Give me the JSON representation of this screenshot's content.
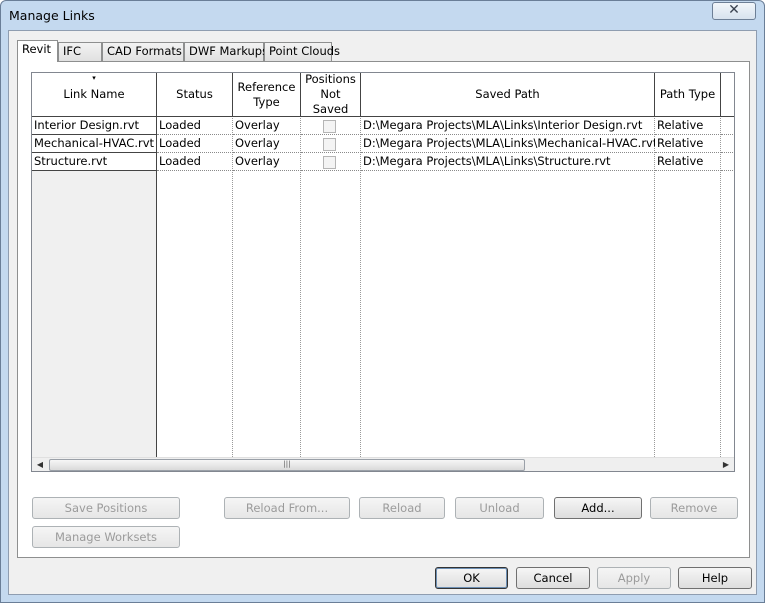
{
  "window": {
    "title": "Manage Links",
    "close_glyph": "✕"
  },
  "tabs": [
    {
      "label": "Revit",
      "active": true
    },
    {
      "label": "IFC"
    },
    {
      "label": "CAD Formats"
    },
    {
      "label": "DWF Markups"
    },
    {
      "label": "Point Clouds"
    }
  ],
  "table": {
    "columns": {
      "link_name": "Link Name",
      "status": "Status",
      "reference_type_1": "Reference",
      "reference_type_2": "Type",
      "positions_1": "Positions",
      "positions_2": "Not Saved",
      "saved_path": "Saved Path",
      "path_type": "Path Type"
    },
    "sort_glyph": "▾",
    "rows": [
      {
        "link_name": "Interior Design.rvt",
        "status": "Loaded",
        "reference_type": "Overlay",
        "positions_not_saved": false,
        "saved_path": "D:\\Megara Projects\\MLA\\Links\\Interior Design.rvt",
        "path_type": "Relative"
      },
      {
        "link_name": "Mechanical-HVAC.rvt",
        "status": "Loaded",
        "reference_type": "Overlay",
        "positions_not_saved": false,
        "saved_path": "D:\\Megara Projects\\MLA\\Links\\Mechanical-HVAC.rvt",
        "path_type": "Relative"
      },
      {
        "link_name": "Structure.rvt",
        "status": "Loaded",
        "reference_type": "Overlay",
        "positions_not_saved": false,
        "saved_path": "D:\\Megara Projects\\MLA\\Links\\Structure.rvt",
        "path_type": "Relative"
      }
    ],
    "scrollbar": {
      "left_glyph": "◀",
      "right_glyph": "▶",
      "grip": "|||"
    }
  },
  "buttons": {
    "save_positions": "Save Positions",
    "manage_worksets": "Manage Worksets",
    "reload_from": "Reload From...",
    "reload": "Reload",
    "unload": "Unload",
    "add": "Add...",
    "remove": "Remove",
    "ok": "OK",
    "cancel": "Cancel",
    "apply": "Apply",
    "help": "Help"
  }
}
